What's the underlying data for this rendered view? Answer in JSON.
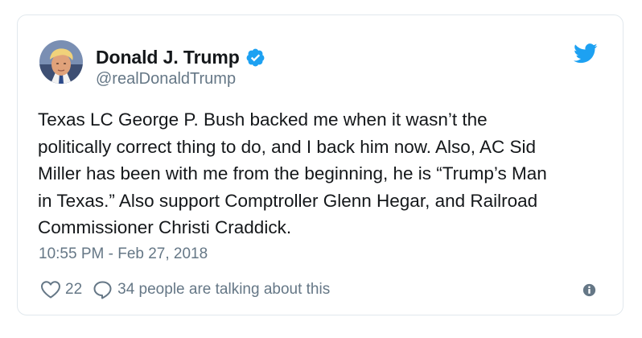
{
  "tweet": {
    "author_name": "Donald J. Trump",
    "author_handle": "@realDonaldTrump",
    "text_lines": [
      "Texas LC George P. Bush backed me when it wasn’t the",
      "politically correct thing to do, and I back him now. Also, AC Sid",
      "Miller has been with me from the beginning, he is “Trump’s Man",
      "in Texas.” Also support Comptroller Glenn Hegar, and Railroad",
      "Commissioner Christi Craddick."
    ],
    "timestamp": "10:55 PM - Feb 27, 2018",
    "like_count": "22",
    "conversation_text": "34 people are talking about this"
  },
  "icons": {
    "avatar": "avatar",
    "verified": "verified-badge-icon",
    "brand": "twitter-bird-icon",
    "like": "heart-icon",
    "reply": "speech-bubble-icon",
    "info": "info-icon"
  },
  "colors": {
    "brand_blue": "#1da1f2",
    "text_primary": "#14171a",
    "text_secondary": "#657786",
    "border": "#e1e8ed"
  }
}
